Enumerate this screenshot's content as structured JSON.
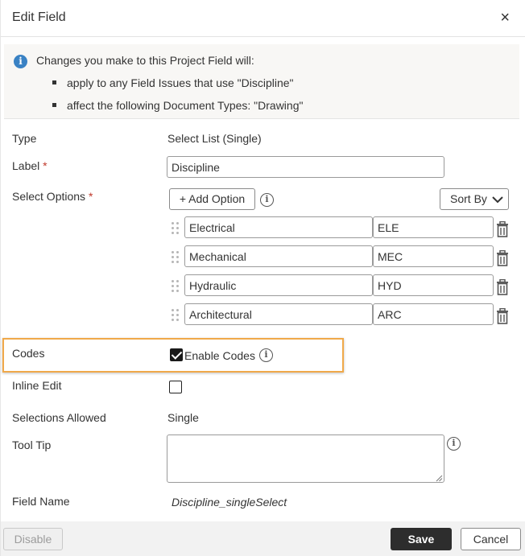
{
  "dialog": {
    "title": "Edit Field",
    "close_label": "×"
  },
  "info": {
    "message": "Changes you make to this Project Field will:",
    "bullets": [
      "apply to any Field Issues that use \"Discipline\"",
      "affect the following Document Types: \"Drawing\""
    ]
  },
  "form": {
    "type": {
      "label": "Type",
      "value": "Select List (Single)"
    },
    "label_field": {
      "label": "Label",
      "required": "*",
      "value": "Discipline"
    },
    "select_options": {
      "label": "Select Options",
      "required": "*",
      "add_button": "+ Add Option",
      "sort_button": "Sort By",
      "options": [
        {
          "name": "Electrical",
          "code": "ELE"
        },
        {
          "name": "Mechanical",
          "code": "MEC"
        },
        {
          "name": "Hydraulic",
          "code": "HYD"
        },
        {
          "name": "Architectural",
          "code": "ARC"
        }
      ]
    },
    "codes": {
      "label": "Codes",
      "checkbox_label": "Enable Codes",
      "checked": true
    },
    "inline_edit": {
      "label": "Inline Edit",
      "checked": false
    },
    "selections_allowed": {
      "label": "Selections Allowed",
      "value": "Single"
    },
    "tool_tip": {
      "label": "Tool Tip",
      "value": ""
    },
    "field_name": {
      "label": "Field Name",
      "value": "Discipline_singleSelect"
    }
  },
  "footer": {
    "disable_label": "Disable",
    "save_label": "Save",
    "cancel_label": "Cancel"
  },
  "colors": {
    "highlight": "#f0a94a",
    "info_icon": "#3a82c4",
    "save_bg": "#2d2d2d",
    "required": "#c0392b"
  },
  "icons": {
    "info": "info-circle-icon",
    "drag": "drag-handle-icon",
    "trash": "trash-icon",
    "close": "close-icon",
    "sort": "chevron-down-icon"
  }
}
